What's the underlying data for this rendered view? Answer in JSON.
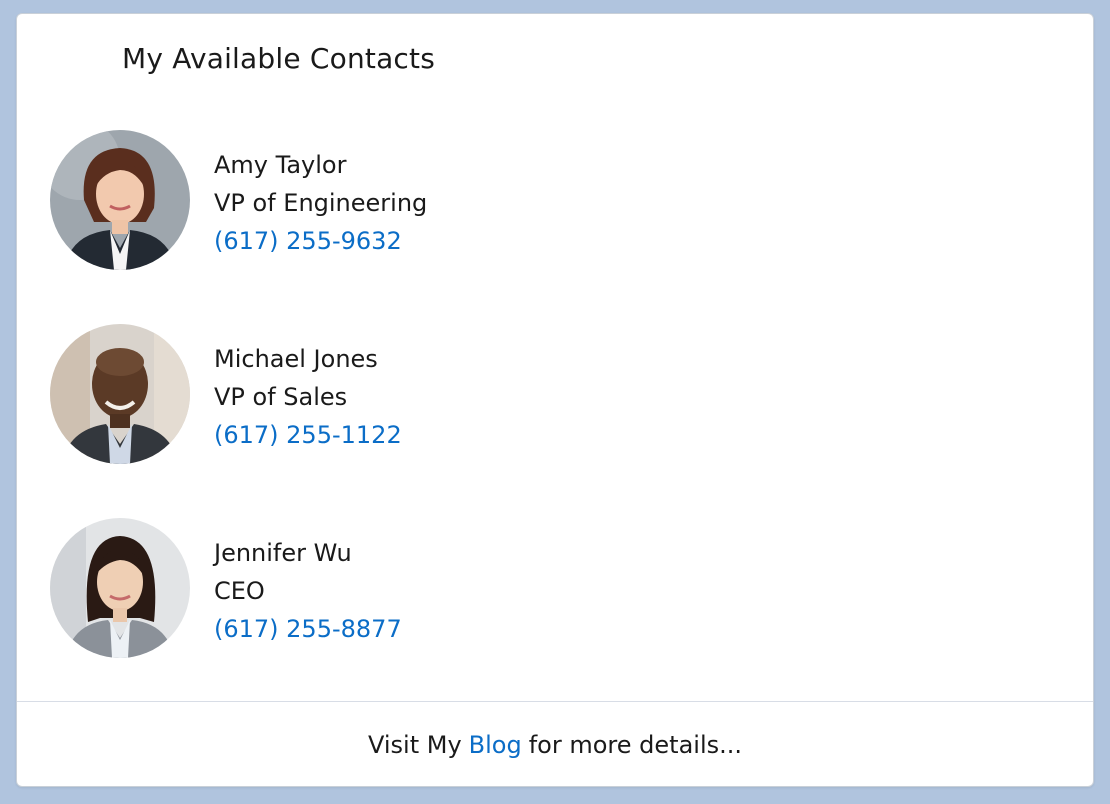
{
  "card": {
    "title": "My Available Contacts"
  },
  "contacts": [
    {
      "name": "Amy Taylor",
      "title": "VP of Engineering",
      "phone": "(617) 255-9632"
    },
    {
      "name": "Michael Jones",
      "title": "VP of Sales",
      "phone": "(617) 255-1122"
    },
    {
      "name": "Jennifer Wu",
      "title": "CEO",
      "phone": "(617) 255-8877"
    }
  ],
  "footer": {
    "prefix": "Visit My",
    "link_label": "Blog",
    "suffix": "for more details..."
  },
  "colors": {
    "page_background": "#b0c4de",
    "link": "#0b6dc7",
    "text": "#1a1a1a"
  },
  "icons": [
    "avatar-amy-taylor",
    "avatar-michael-jones",
    "avatar-jennifer-wu"
  ]
}
